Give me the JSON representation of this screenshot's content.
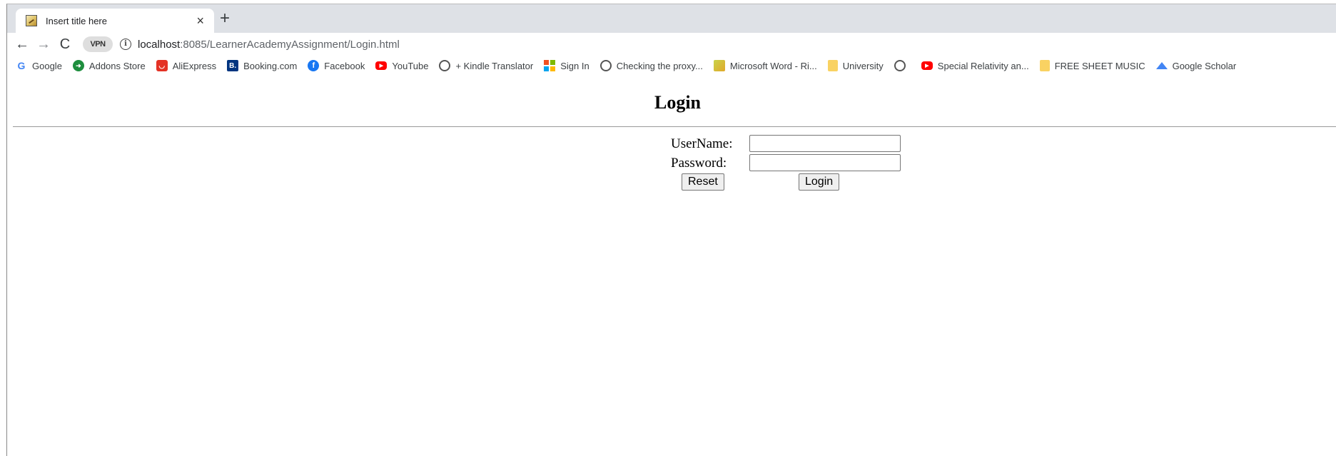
{
  "browser": {
    "tab": {
      "title": "Insert title here",
      "close_glyph": "×",
      "favicon": "page-favicon-icon"
    },
    "new_tab_glyph": "+",
    "nav": {
      "back_glyph": "←",
      "forward_glyph": "→",
      "reload_glyph": "C"
    },
    "vpn_label": "VPN",
    "info_glyph": "i",
    "url": {
      "host": "localhost",
      "rest": ":8085/LearnerAcademyAssignment/Login.html"
    },
    "bookmarks": [
      {
        "label": "Google",
        "icon": "google-icon",
        "glyph": "G"
      },
      {
        "label": "Addons Store",
        "icon": "addons-store-icon",
        "glyph": "➜"
      },
      {
        "label": "AliExpress",
        "icon": "aliexpress-icon",
        "glyph": "◡"
      },
      {
        "label": "Booking.com",
        "icon": "booking-icon",
        "glyph": "B."
      },
      {
        "label": "Facebook",
        "icon": "facebook-icon",
        "glyph": "f"
      },
      {
        "label": "YouTube",
        "icon": "youtube-icon",
        "glyph": "▶"
      },
      {
        "label": "+ Kindle Translator",
        "icon": "globe-icon",
        "glyph": ""
      },
      {
        "label": "Sign In",
        "icon": "microsoft-icon",
        "glyph": ""
      },
      {
        "label": "Checking the proxy...",
        "icon": "globe-icon",
        "glyph": ""
      },
      {
        "label": "Microsoft Word - Ri...",
        "icon": "word-doc-icon",
        "glyph": ""
      },
      {
        "label": "University",
        "icon": "folder-icon",
        "glyph": ""
      },
      {
        "label": "",
        "icon": "globe-icon",
        "glyph": ""
      },
      {
        "label": "Special Relativity an...",
        "icon": "youtube-icon",
        "glyph": "▶"
      },
      {
        "label": "FREE SHEET MUSIC",
        "icon": "folder-icon",
        "glyph": ""
      },
      {
        "label": "Google Scholar",
        "icon": "scholar-icon",
        "glyph": ""
      }
    ]
  },
  "page": {
    "title": "Login",
    "form": {
      "username_label": "UserName:",
      "username_value": "",
      "password_label": "Password:",
      "password_value": "",
      "reset_label": "Reset",
      "login_label": "Login"
    }
  }
}
